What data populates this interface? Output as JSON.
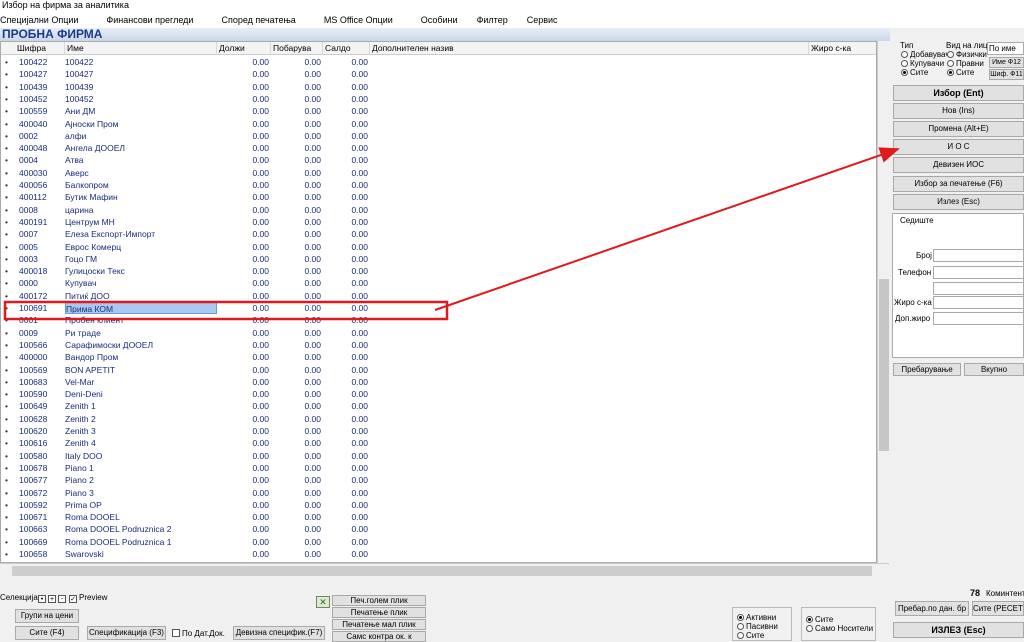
{
  "window": {
    "title": "Избор на фирма за аналитика"
  },
  "menu": [
    "Специјални Опции",
    "Финансови прегледи",
    "Според печатења",
    "MS Office Опции",
    "Особини",
    "Филтер",
    "Сервис"
  ],
  "banner": "ПРОБНА ФИРМА",
  "grid": {
    "columns": [
      "Шифра",
      "Име",
      "Должи",
      "Побарува",
      "Салдо",
      "Дополнителен назив",
      "Жиро с-ка"
    ],
    "rows": [
      [
        "100422",
        "100422",
        "0.00",
        "0.00",
        "0.00"
      ],
      [
        "100427",
        "100427",
        "0.00",
        "0.00",
        "0.00"
      ],
      [
        "100439",
        "100439",
        "0.00",
        "0.00",
        "0.00"
      ],
      [
        "100452",
        "100452",
        "0.00",
        "0.00",
        "0.00"
      ],
      [
        "100559",
        "Ани ДМ",
        "0.00",
        "0.00",
        "0.00"
      ],
      [
        "400040",
        "Ајноски Пром",
        "0.00",
        "0.00",
        "0.00"
      ],
      [
        "0002",
        "алфи",
        "0.00",
        "0.00",
        "0.00"
      ],
      [
        "400048",
        "Ангела ДООЕЛ",
        "0.00",
        "0.00",
        "0.00"
      ],
      [
        "0004",
        "Атва",
        "0.00",
        "0.00",
        "0.00"
      ],
      [
        "400030",
        "Аверс",
        "0.00",
        "0.00",
        "0.00"
      ],
      [
        "400056",
        "Балкопром",
        "0.00",
        "0.00",
        "0.00"
      ],
      [
        "400112",
        "Бутик Мафин",
        "0.00",
        "0.00",
        "0.00"
      ],
      [
        "0008",
        "царина",
        "0.00",
        "0.00",
        "0.00"
      ],
      [
        "400191",
        "Центрум МН",
        "0.00",
        "0.00",
        "0.00"
      ],
      [
        "0007",
        "Елеза Експорт-Импорт",
        "0.00",
        "0.00",
        "0.00"
      ],
      [
        "0005",
        "Еврос Комерц",
        "0.00",
        "0.00",
        "0.00"
      ],
      [
        "0003",
        "Гоцо ГМ",
        "0.00",
        "0.00",
        "0.00"
      ],
      [
        "400018",
        "Гулицоски Текс",
        "0.00",
        "0.00",
        "0.00"
      ],
      [
        "0000",
        "Купувач",
        "0.00",
        "0.00",
        "0.00"
      ],
      [
        "400172",
        "Питиќ ДОО",
        "0.00",
        "0.00",
        "0.00"
      ],
      [
        "100691",
        "Прима КОМ",
        "0.00",
        "0.00",
        "0.00"
      ],
      [
        "0001",
        "Пробен клиент",
        "0.00",
        "0.00",
        "0.00"
      ],
      [
        "0009",
        "Ри траде",
        "0.00",
        "0.00",
        "0.00"
      ],
      [
        "100566",
        "Сарафимоски ДООЕЛ",
        "0.00",
        "0.00",
        "0.00"
      ],
      [
        "400000",
        "Вандор Пром",
        "0.00",
        "0.00",
        "0.00"
      ],
      [
        "100569",
        "BON APETIT",
        "0.00",
        "0.00",
        "0.00"
      ],
      [
        "100683",
        "Vel-Mar",
        "0.00",
        "0.00",
        "0.00"
      ],
      [
        "100590",
        "Deni-Deni",
        "0.00",
        "0.00",
        "0.00"
      ],
      [
        "100649",
        "Zenith 1",
        "0.00",
        "0.00",
        "0.00"
      ],
      [
        "100628",
        "Zenith 2",
        "0.00",
        "0.00",
        "0.00"
      ],
      [
        "100620",
        "Zenith 3",
        "0.00",
        "0.00",
        "0.00"
      ],
      [
        "100616",
        "Zenith 4",
        "0.00",
        "0.00",
        "0.00"
      ],
      [
        "100580",
        "Italy DOO",
        "0.00",
        "0.00",
        "0.00"
      ],
      [
        "100678",
        "Piano 1",
        "0.00",
        "0.00",
        "0.00"
      ],
      [
        "100677",
        "Piano 2",
        "0.00",
        "0.00",
        "0.00"
      ],
      [
        "100672",
        "Piano 3",
        "0.00",
        "0.00",
        "0.00"
      ],
      [
        "100592",
        "Prima OP",
        "0.00",
        "0.00",
        "0.00"
      ],
      [
        "100671",
        "Roma DOOEL",
        "0.00",
        "0.00",
        "0.00"
      ],
      [
        "100663",
        "Roma DOOEL Podruznica 2",
        "0.00",
        "0.00",
        "0.00"
      ],
      [
        "100669",
        "Roma DOOEL Podruznica 1",
        "0.00",
        "0.00",
        "0.00"
      ],
      [
        "100658",
        "Swarovski",
        "0.00",
        "0.00",
        "0.00"
      ]
    ]
  },
  "right": {
    "tip_label": "Тип",
    "tip_options": [
      "Добавувач",
      "Купувачи",
      "Сите"
    ],
    "vid_label": "Вид на лица",
    "vid_options": [
      "Физички",
      "Правни",
      "Сите"
    ],
    "sort_value": "По име",
    "btn_ime_f12": "Име Ф12",
    "btn_shif_f11": "Шиф. Ф11",
    "btn_izbor": "Избор (Ent)",
    "btn_nov": "Нов (Ins)",
    "btn_promena": "Промена (Alt+E)",
    "btn_ios": "И О С",
    "btn_devizen_ios": "Девизен ИОС",
    "btn_izbor_pecatenje": "Избор за печатење (F6)",
    "btn_izlez": "Излез (Esc)",
    "sediste_label": "Седиште",
    "broj_label": "Број",
    "telefon_label": "Телефон",
    "ziro_label": "Жиро с-ка",
    "dop_ziro_label": "Доп.жиро",
    "btn_prebaruvanje": "Пребарување",
    "btn_vkupno": "Вкупно",
    "count_value": "78",
    "count_label": "Коминтенти",
    "btn_prebar_po_dan": "Пребар.по дан. бр",
    "btn_site_reset": "Сите (РЕСЕТ)",
    "btn_izlez_big": "ИЗЛЕЗ   (Esc)"
  },
  "bottom": {
    "selekcija_label": "Селекција",
    "preview_label": "Preview",
    "btn_grupi": "Групи на цени",
    "btn_site_f4": "Сите (F4)",
    "btn_specifikacija": "Спецификација (F3)",
    "po_dat_dok_label": "По Дат.Док.",
    "btn_devizna": "Девизна специфик.(F7)",
    "btn_pecatogolem": "Печ.голем плик",
    "btn_pecatenje_plik": "Печатење плик",
    "btn_pecatenje_mal": "Печатење мал плик",
    "btn_cut": "Самс контра ок. к",
    "aktivni_options": [
      "Активни",
      "Пасивни",
      "Сите"
    ],
    "nositeli_options": [
      "Сите",
      "Само Носители"
    ]
  }
}
